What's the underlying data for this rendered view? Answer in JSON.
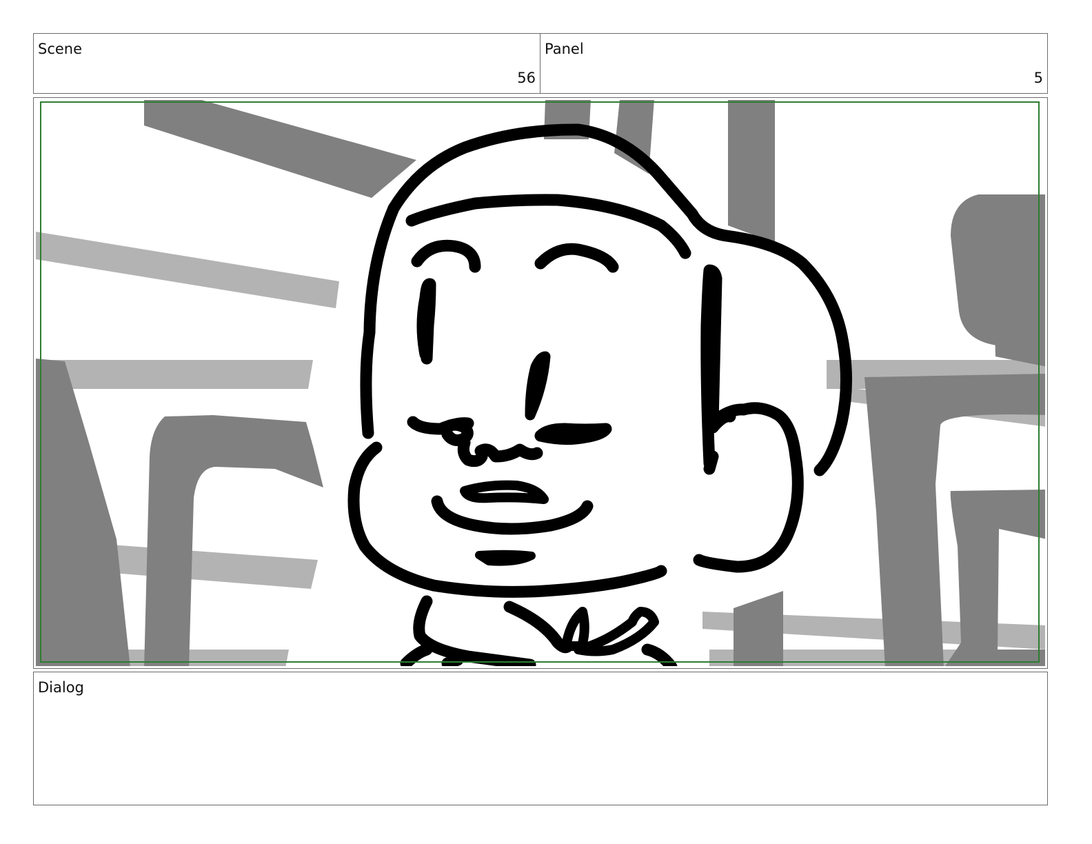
{
  "header": {
    "scene": {
      "label": "Scene",
      "value": "56"
    },
    "panel": {
      "label": "Panel",
      "value": "5"
    }
  },
  "frame": {
    "safe_area_color": "#2e7d32",
    "bg_dark": "#808080",
    "bg_light": "#b3b3b3",
    "ink": "#000000"
  },
  "dialog": {
    "label": "Dialog",
    "text": ""
  }
}
